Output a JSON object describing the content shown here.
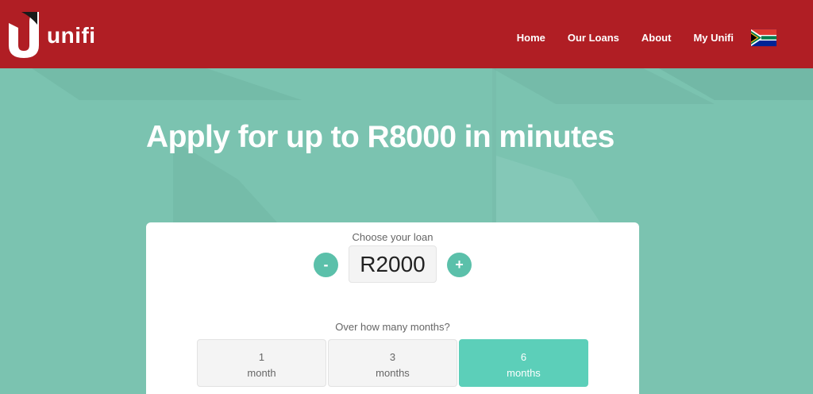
{
  "brand": {
    "name": "unifi"
  },
  "nav": {
    "items": [
      {
        "label": "Home"
      },
      {
        "label": "Our Loans"
      },
      {
        "label": "About"
      },
      {
        "label": "My Unifi"
      }
    ]
  },
  "hero": {
    "title": "Apply for up to R8000 in minutes"
  },
  "loan": {
    "label": "Choose your loan",
    "minus": "-",
    "plus": "+",
    "amount": "R2000"
  },
  "months": {
    "label": "Over how many months?",
    "options": [
      {
        "value": "1",
        "unit": "month",
        "selected": false
      },
      {
        "value": "3",
        "unit": "months",
        "selected": false
      },
      {
        "value": "6",
        "unit": "months",
        "selected": true
      }
    ]
  },
  "colors": {
    "header": "#b01e24",
    "background": "#7bc3b0",
    "accent": "#5bc0aa",
    "selected": "#5ccfb9"
  },
  "icons": {
    "flag": "south-africa-flag-icon",
    "logo": "unifi-logo-icon"
  }
}
